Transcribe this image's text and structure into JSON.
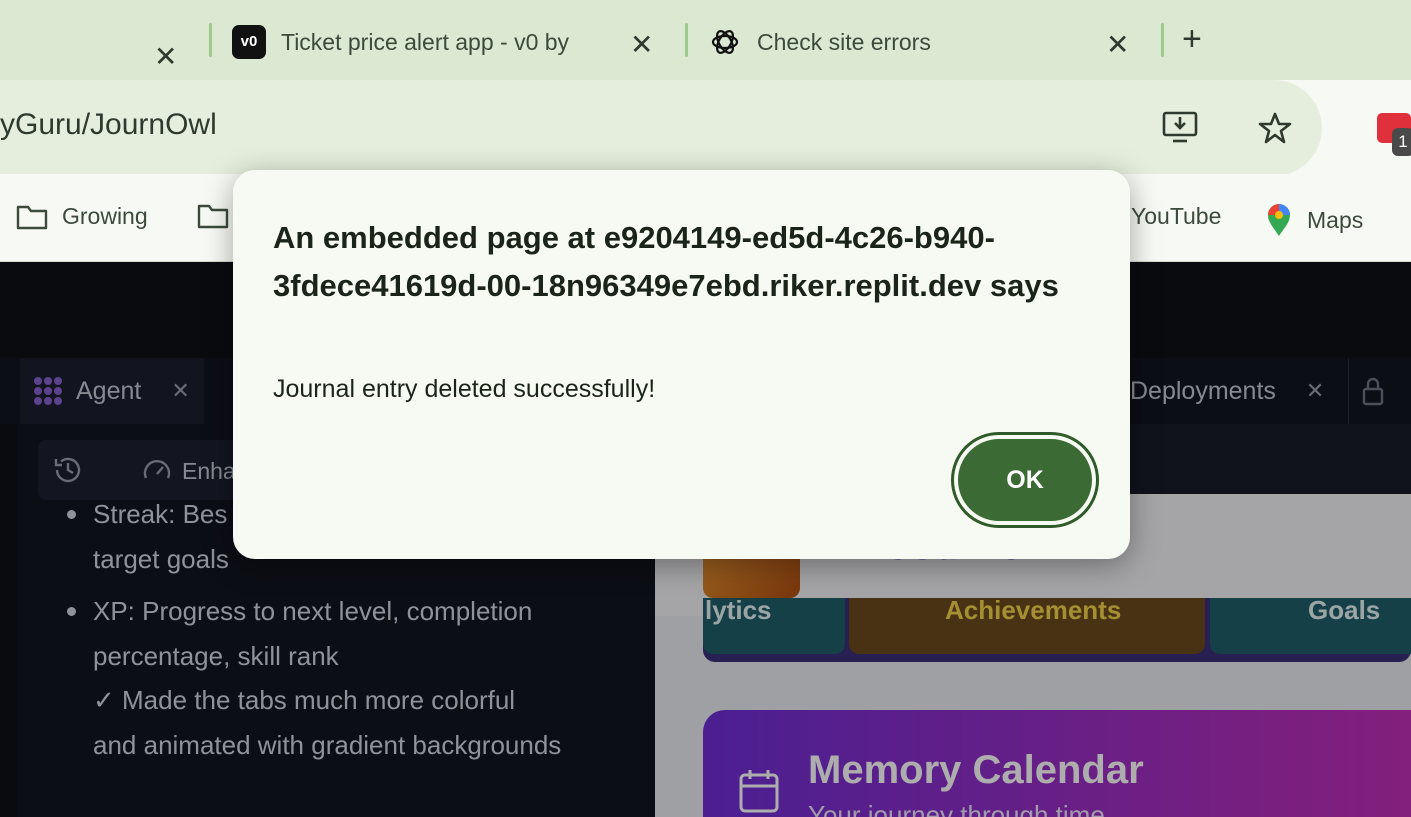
{
  "browser": {
    "tabs": [
      {
        "title": "Ticket price alert app - v0 by",
        "icon": "v0-icon"
      },
      {
        "title": "Check site errors",
        "icon": "openai-icon"
      }
    ],
    "new_tab_label": "+",
    "address": "yGuru/JournOwl",
    "extension_badge": "1"
  },
  "bookmarks": [
    {
      "label": "Growing",
      "icon": "folder-icon"
    },
    {
      "label": "YouTube",
      "icon": "youtube-icon"
    },
    {
      "label": "Maps",
      "icon": "maps-pin-icon"
    }
  ],
  "workspace": {
    "tabs": [
      {
        "label": "Agent"
      },
      {
        "label": "Deployments"
      }
    ],
    "agent_toolbar_label": "Enha",
    "chat_lines": {
      "line1": "Streak: Bes",
      "line2": "target goals",
      "bullet2": "XP: Progress to next level, completion percentage, skill rank",
      "line4": "✓ Made the tabs much more colorful and animated with gradient backgrounds"
    }
  },
  "preview": {
    "app_name": "Journowl",
    "tabs": [
      "lytics",
      "Achievements",
      "Goals"
    ],
    "calendar_title": "Memory Calendar",
    "calendar_subtitle": "Your journey through time"
  },
  "dialog": {
    "title": "An embedded page at e9204149-ed5d-4c26-b940-3fdece41619d-00-18n96349e7ebd.riker.replit.dev says",
    "message": "Journal entry deleted successfully!",
    "ok_label": "OK"
  }
}
